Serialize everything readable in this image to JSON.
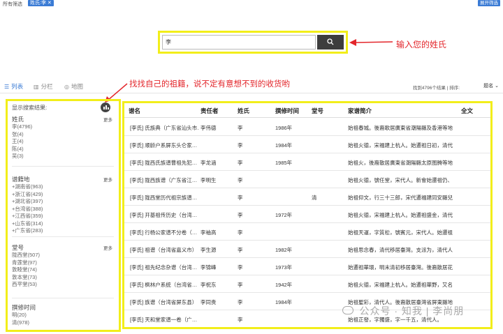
{
  "filter_bar": {
    "label": "所有筛选",
    "tag": "姓氏:李 ✕",
    "expand_label": "展开筛选"
  },
  "search": {
    "value": "李",
    "annotation": "输入您的姓氏"
  },
  "view_bar": {
    "list": "列表",
    "columns": "分栏",
    "map": "地图",
    "result_count": "找到4796个结果",
    "sort_label": "排序:",
    "sort_value": "题名",
    "annotation": "找找自己的祖籍，说不定有意想不到的收货哟"
  },
  "facets": {
    "heading": "显示搜索结果:",
    "more": "更多",
    "groups": [
      {
        "title": "姓氏",
        "items": [
          "李(4796)",
          "张(4)",
          "王(4)",
          "陈(4)",
          "吴(3)"
        ]
      },
      {
        "title": "谱籍地",
        "items": [
          "+湖南省(963)",
          "+浙江省(429)",
          "+湖北省(397)",
          "+台湾省(388)",
          "+江西省(359)",
          "+山东省(314)",
          "+广东省(283)"
        ]
      },
      {
        "title": "堂号",
        "items": [
          "陇西堂(507)",
          "青莲堂(97)",
          "敦睦堂(74)",
          "敦本堂(73)",
          "西平堂(53)"
        ]
      },
      {
        "title": "撰修时间",
        "items": [
          "明(20)",
          "清(978)"
        ]
      }
    ]
  },
  "table": {
    "headers": [
      "谱名",
      "责任者",
      "姓氏",
      "撰修时间",
      "堂号",
      "家谱简介",
      "全文"
    ],
    "rows": [
      [
        "[李氏] 氏族典（广东省汕头市…",
        "李伟德",
        "李",
        "1986年",
        "",
        "始祖春城。後裔歌居廣東省潮陽縣及香港等地。"
      ],
      [
        "[李氏] 顺龄户系屏东头仑家…",
        "",
        "李",
        "1984年",
        "",
        "始祖火德，宋福建上杭人。始遷祖日初，清代…"
      ],
      [
        "[李氏] 陇西氏族谱曹祖先犯…",
        "李龙涵",
        "李",
        "1985年",
        "",
        "始祖火，後裔散居廣東省潮陽縣太原图腾等地。"
      ],
      [
        "[李氏] 陇西族谱（广东省江…",
        "李明生",
        "李",
        "",
        "",
        "始祖火德，號任堂，宋代人。新會始遷祖仍、倪…"
      ],
      [
        "[李氏] 陇西堂历代祖宗族谱…",
        "",
        "李",
        "",
        "清",
        "始祖仰文，行三十三郎，宋代遷福建同安縣兒…"
      ],
      [
        "[李氏] 开基祖传历史（台湾…",
        "",
        "李",
        "1972年",
        "",
        "始祖火德，宋福建上杭人。始遷祖盛金，清代…"
      ],
      [
        "[李氏] 行杨公家谱不分卷（…",
        "李袖高",
        "李",
        "",
        "",
        "始祖天運，字質松，號賓元，宋代人。始遷祖…"
      ],
      [
        "[李氏] 祖谱（台湾省嘉义市）",
        "李生源",
        "李",
        "1982年",
        "",
        "始祖思念春，清代移居臺灣。支派为，清代人…"
      ],
      [
        "[李氏] 祖先纪念杂谱（台湾…",
        "李锦峰",
        "李",
        "1973年",
        "",
        "始遷祖華環，明末清初移居臺灣。後裔散居花…"
      ],
      [
        "[李氏] 枫林户系统（台湾省…",
        "李祝东",
        "李",
        "1942年",
        "",
        "始祖火德，宋福建上杭人。始遷祖華野，又名…"
      ],
      [
        "[李氏] 族谱（台湾省屏东县）",
        "李同贵",
        "李",
        "1984年",
        "",
        "始祖聖彩，清代人。後裔散居臺灣省屏東縣地上…"
      ],
      [
        "[李氏] 天和堂家谱一卷（广…",
        "",
        "李",
        "",
        "",
        "始祖正發，字獨盛，字一千五，清代人。"
      ]
    ]
  },
  "watermark": "公众号 · 知我 | 李尚朋"
}
